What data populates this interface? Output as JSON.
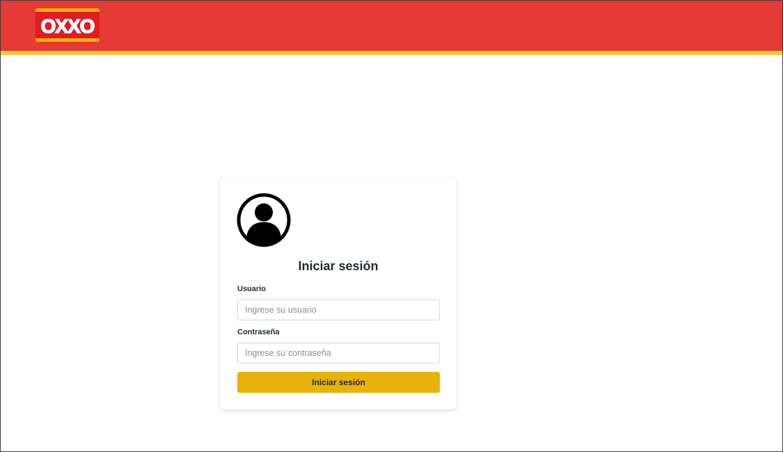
{
  "header": {
    "logo_text": "OXXO",
    "colors": {
      "background": "#e63a35",
      "accent_bar": "#f9c93a"
    }
  },
  "login": {
    "avatar_icon": "user-circle-icon",
    "title": "Iniciar sesión",
    "username_label": "Usuario",
    "username_placeholder": "Ingrese su usuario",
    "username_value": "",
    "password_label": "Contraseña",
    "password_placeholder": "Ingrese su contraseña",
    "password_value": "",
    "submit_label": "Iniciar sesión",
    "colors": {
      "button": "#e8b20a"
    }
  }
}
